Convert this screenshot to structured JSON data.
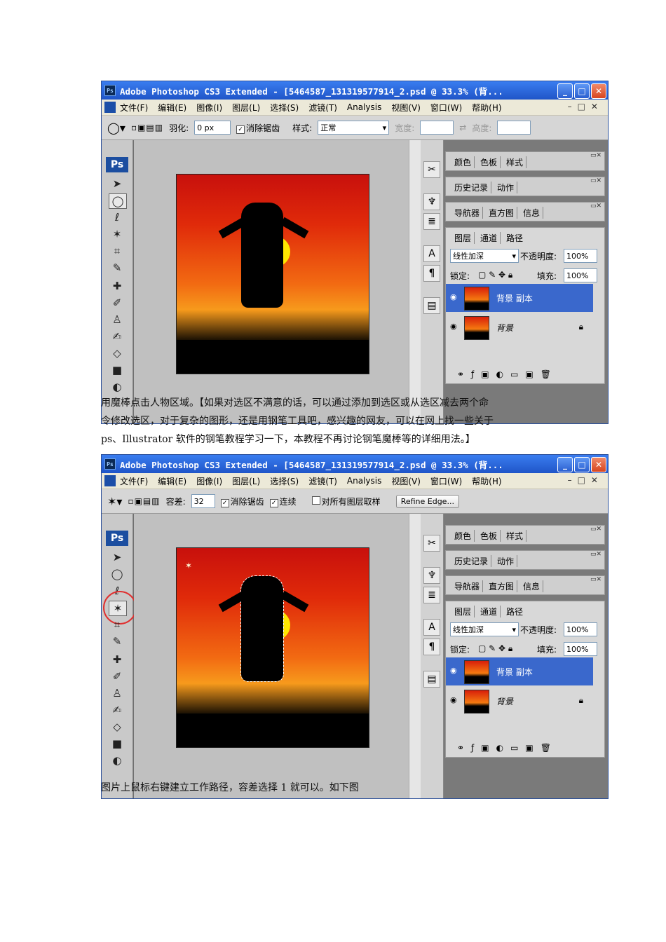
{
  "screens": [
    {
      "title": "Adobe Photoshop CS3 Extended - [5464587_131319577914_2.psd @ 33.3% (背...",
      "menu": [
        "文件(F)",
        "编辑(E)",
        "图像(I)",
        "图层(L)",
        "选择(S)",
        "滤镜(T)",
        "Analysis",
        "视图(V)",
        "窗口(W)",
        "帮助(H)"
      ],
      "options": {
        "feather_label": "羽化:",
        "feather_value": "0 px",
        "antialias_label": "消除锯齿",
        "style_label": "样式:",
        "style_value": "正常",
        "width_label": "宽度:",
        "height_label": "高度:"
      },
      "status_zoom": "33.33%"
    },
    {
      "title": "Adobe Photoshop CS3 Extended - [5464587_131319577914_2.psd @ 33.3% (背...",
      "menu": [
        "文件(F)",
        "编辑(E)",
        "图像(I)",
        "图层(L)",
        "选择(S)",
        "滤镜(T)",
        "Analysis",
        "视图(V)",
        "窗口(W)",
        "帮助(H)"
      ],
      "options": {
        "tolerance_label": "容差:",
        "tolerance_value": "32",
        "antialias_label": "消除锯齿",
        "contiguous_label": "连续",
        "sample_all_label": "对所有图层取样",
        "refine_edge_label": "Refine Edge..."
      },
      "status_zoom": "33.33%"
    }
  ],
  "panels": {
    "group1": [
      "颜色",
      "色板",
      "样式"
    ],
    "group2": [
      "历史记录",
      "动作"
    ],
    "group3": [
      "导航器",
      "直方图",
      "信息"
    ],
    "group4": [
      "图层",
      "通道",
      "路径"
    ],
    "blend_mode": "线性加深",
    "opacity_label": "不透明度:",
    "opacity_value": "100%",
    "lock_label": "锁定:",
    "fill_label": "填充:",
    "fill_value": "100%",
    "layers": [
      "背景 副本",
      "背景"
    ]
  },
  "text": {
    "para1_line1": "用魔棒点击人物区域。【如果对选区不满意的话，可以通过添加到选区或从选区减去两个命",
    "para1_line2": "令修改选区，对于复杂的图形，还是用钢笔工具吧，感兴趣的网友，可以在网上找一些关于",
    "para1_line3": "ps、Illustrator 软件的钢笔教程学习一下，本教程不再讨论钢笔魔棒等的详细用法。】",
    "para2_line1": "图片上鼠标右键建立工作路径，容差选择 1 就可以。如下图"
  }
}
